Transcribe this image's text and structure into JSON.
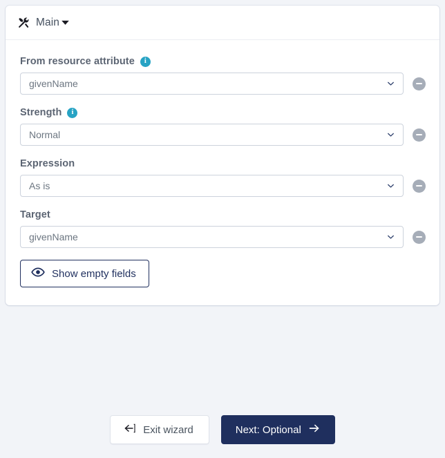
{
  "panel": {
    "title": "Main",
    "icon": "tools-icon",
    "collapse_icon": "caret-down-icon"
  },
  "fields": [
    {
      "label": "From resource attribute",
      "has_info": true,
      "value": "givenName",
      "removable": true
    },
    {
      "label": "Strength",
      "has_info": true,
      "value": "Normal",
      "removable": true
    },
    {
      "label": "Expression",
      "has_info": false,
      "value": "As is",
      "removable": true
    },
    {
      "label": "Target",
      "has_info": true,
      "value": "givenName",
      "removable": true
    }
  ],
  "show_empty_fields": {
    "label": "Show empty fields",
    "icon": "eye-icon"
  },
  "footer": {
    "exit": {
      "label": "Exit wizard",
      "icon": "exit-icon"
    },
    "next": {
      "label": "Next: Optional",
      "icon": "arrow-right-icon"
    }
  },
  "colors": {
    "page_background": "#f2f4f8",
    "card_background": "#ffffff",
    "primary": "#1f2f5e",
    "info_icon": "#27a3c4",
    "label_text": "#5c6573",
    "value_text": "#6c7681",
    "remove_button": "#a6adb8"
  }
}
